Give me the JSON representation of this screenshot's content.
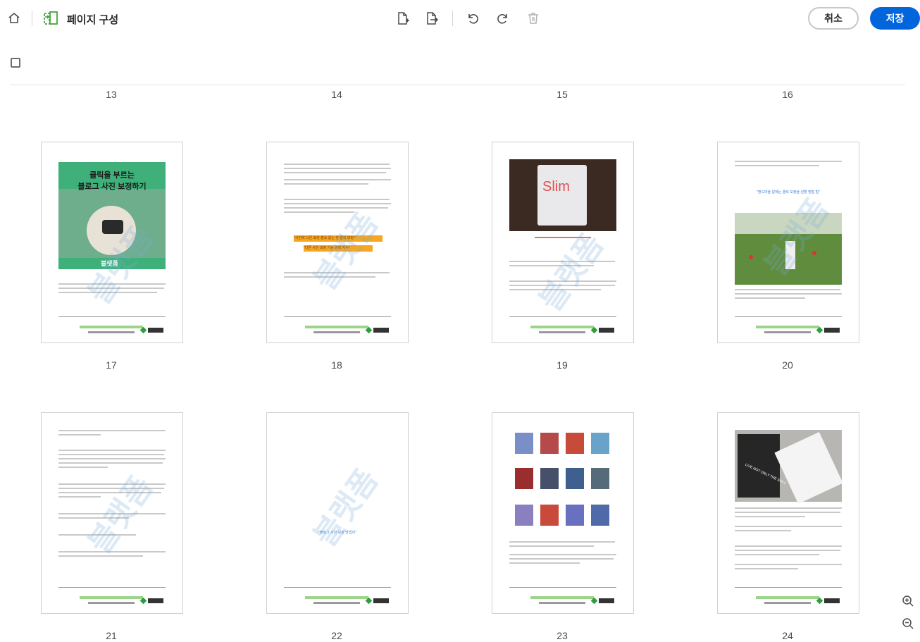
{
  "toolbar": {
    "title": "페이지 구성",
    "cancel_label": "취소",
    "save_label": "저장",
    "icons": [
      "home-icon",
      "organize-pages-icon",
      "insert-page-icon",
      "extract-page-icon",
      "undo-icon",
      "redo-icon",
      "delete-icon"
    ]
  },
  "pages": {
    "top_row_numbers": [
      "13",
      "14",
      "15",
      "16"
    ],
    "row1": [
      {
        "number": "17",
        "banner_title_1": "클릭을 부르는",
        "banner_title_2": "블로그 사진 보정하기",
        "brand": "블랫폼",
        "quote_1": "",
        "quote_2": ""
      },
      {
        "number": "18",
        "quote_1": "\"사진에 다른 표현 필요 없는 한 클릭 보정 \"",
        "quote_2": "\"다른 사진 보정 기능 강력 지수\""
      },
      {
        "number": "19",
        "product_text": "Slim"
      },
      {
        "number": "20",
        "quote": "\"핸드마을 없애는 클릭 보정을 원할 방법 팁\""
      }
    ],
    "row2": [
      {
        "number": "21"
      },
      {
        "number": "22",
        "quote": "\"블로그 사진 보정 방법이\""
      },
      {
        "number": "23"
      },
      {
        "number": "24",
        "product_text": "LIVE NOT ONLY THE SKILL"
      }
    ],
    "footer_url": "https://www.kakao.com/wyxmabc",
    "footer_brand": "블랫폼",
    "watermark": "블랫폼"
  },
  "colors": {
    "accent": "#0265dc",
    "banner_green": "#3fb07a",
    "highlight_orange": "#f5a623",
    "quote_blue": "#3a7bd5"
  },
  "zoom": {
    "in_icon": "zoom-in-icon",
    "out_icon": "zoom-out-icon"
  }
}
